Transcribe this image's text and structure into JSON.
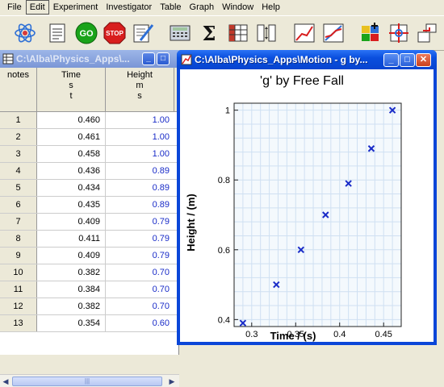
{
  "menu": [
    "File",
    "Edit",
    "Experiment",
    "Investigator",
    "Table",
    "Graph",
    "Window",
    "Help"
  ],
  "toolbar": {
    "buttons": [
      {
        "name": "atom-icon"
      },
      {
        "name": "notepad-icon"
      },
      {
        "name": "go-button",
        "label": "GO",
        "color": "#1aa31a"
      },
      {
        "name": "stop-button",
        "label": "STOP",
        "color": "#d81e1e"
      },
      {
        "name": "notebook-pen-icon"
      },
      {
        "name": "calculator-icon"
      },
      {
        "name": "sigma-icon",
        "label": "Σ"
      },
      {
        "name": "table-icon"
      },
      {
        "name": "column-swap-icon"
      },
      {
        "name": "graph-icon"
      },
      {
        "name": "graph-fit-icon"
      },
      {
        "name": "new-graph-icon"
      },
      {
        "name": "crosshair-icon"
      },
      {
        "name": "transfer-icon"
      }
    ]
  },
  "table_window": {
    "title": "C:\\Alba\\Physics_Apps\\...",
    "columns": [
      {
        "label": "notes"
      },
      {
        "label": "Time",
        "unit": "s",
        "symbol": "t"
      },
      {
        "label": "Height",
        "unit": "m",
        "symbol": "s"
      }
    ],
    "rows": [
      {
        "n": "1",
        "time": "0.460",
        "height": "1.00"
      },
      {
        "n": "2",
        "time": "0.461",
        "height": "1.00"
      },
      {
        "n": "3",
        "time": "0.458",
        "height": "1.00"
      },
      {
        "n": "4",
        "time": "0.436",
        "height": "0.89"
      },
      {
        "n": "5",
        "time": "0.434",
        "height": "0.89"
      },
      {
        "n": "6",
        "time": "0.435",
        "height": "0.89"
      },
      {
        "n": "7",
        "time": "0.409",
        "height": "0.79"
      },
      {
        "n": "8",
        "time": "0.411",
        "height": "0.79"
      },
      {
        "n": "9",
        "time": "0.409",
        "height": "0.79"
      },
      {
        "n": "10",
        "time": "0.382",
        "height": "0.70"
      },
      {
        "n": "11",
        "time": "0.384",
        "height": "0.70"
      },
      {
        "n": "12",
        "time": "0.382",
        "height": "0.70"
      },
      {
        "n": "13",
        "time": "0.354",
        "height": "0.60"
      }
    ]
  },
  "graph_window": {
    "title": "C:\\Alba\\Physics_Apps\\Motion - g by..."
  },
  "chart_data": {
    "type": "scatter",
    "title": "'g' by Free Fall",
    "xlabel": "Time / (s)",
    "ylabel": "Height / (m)",
    "xlim": [
      0.28,
      0.47
    ],
    "ylim": [
      0.38,
      1.02
    ],
    "xticks": [
      0.3,
      0.35,
      0.4,
      0.45
    ],
    "xtick_labels": [
      "0.3",
      "0.35",
      "0.4",
      "0.45"
    ],
    "yticks": [
      0.4,
      0.6,
      0.8,
      1.0
    ],
    "ytick_labels": [
      "0.4",
      "0.6",
      "0.8",
      "1"
    ],
    "grid": true,
    "marker_color": "#1a2cc8",
    "points": [
      {
        "x": 0.29,
        "y": 0.39
      },
      {
        "x": 0.328,
        "y": 0.5
      },
      {
        "x": 0.356,
        "y": 0.6
      },
      {
        "x": 0.384,
        "y": 0.7
      },
      {
        "x": 0.41,
        "y": 0.79
      },
      {
        "x": 0.436,
        "y": 0.89
      },
      {
        "x": 0.46,
        "y": 1.0
      }
    ]
  }
}
